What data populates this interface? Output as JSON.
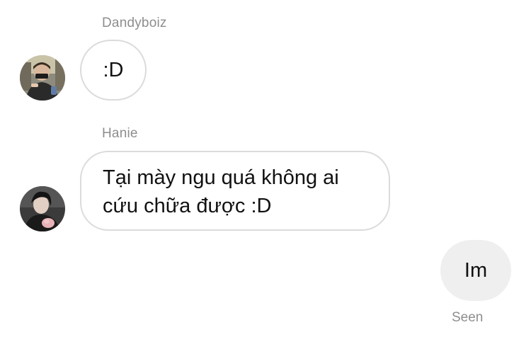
{
  "thread": {
    "messages": [
      {
        "sender": "Dandyboiz",
        "text": ":D",
        "direction": "incoming",
        "avatar_icon": "user-avatar-dandyboiz"
      },
      {
        "sender": "Hanie",
        "text": "Tại mày ngu quá không ai cứu chữa được :D",
        "direction": "incoming",
        "avatar_icon": "user-avatar-hanie"
      },
      {
        "sender": "",
        "text": "Im",
        "direction": "outgoing",
        "status": "Seen"
      }
    ]
  },
  "colors": {
    "incoming_border": "#dbdbdb",
    "outgoing_bg": "#efefef",
    "meta_text": "#8e8e8e"
  }
}
